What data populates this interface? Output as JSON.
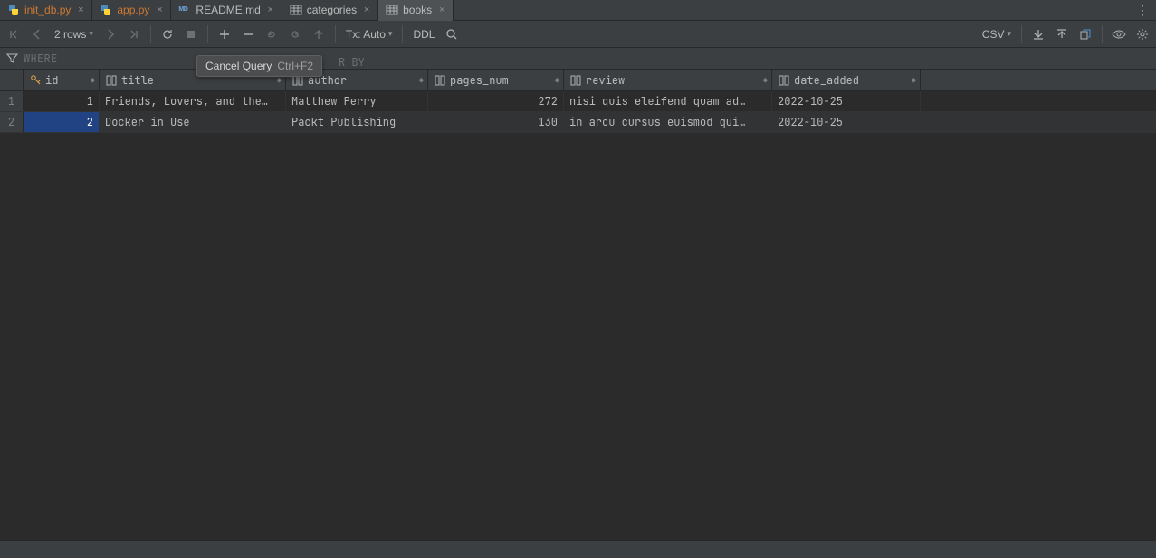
{
  "tabs": [
    {
      "label": "init_db.py",
      "kind": "py",
      "orange": true
    },
    {
      "label": "app.py",
      "kind": "py",
      "orange": true
    },
    {
      "label": "README.md",
      "kind": "md",
      "orange": false
    },
    {
      "label": "categories",
      "kind": "table",
      "orange": false
    },
    {
      "label": "books",
      "kind": "table",
      "orange": false
    }
  ],
  "toolbar": {
    "row_count": "2 rows",
    "tx_mode": "Tx: Auto",
    "ddl_label": "DDL",
    "csv_label": "CSV"
  },
  "filter": {
    "where_ph": "WHERE",
    "orderby_peek": "R BY"
  },
  "tooltip": {
    "label": "Cancel Query",
    "shortcut": "Ctrl+F2"
  },
  "columns": [
    {
      "name": "id"
    },
    {
      "name": "title"
    },
    {
      "name": "author"
    },
    {
      "name": "pages_num"
    },
    {
      "name": "review"
    },
    {
      "name": "date_added"
    }
  ],
  "rows": [
    {
      "n": "1",
      "id": "1",
      "title": "Friends, Lovers, and the…",
      "author": "Matthew Perry",
      "pages_num": "272",
      "review": "nisi quis eleifend quam ad…",
      "date_added": "2022-10-25"
    },
    {
      "n": "2",
      "id": "2",
      "title": "Docker in Use",
      "author": "Packt Publishing",
      "pages_num": "130",
      "review": "in arcu cursus euismod qui…",
      "date_added": "2022-10-25"
    }
  ]
}
